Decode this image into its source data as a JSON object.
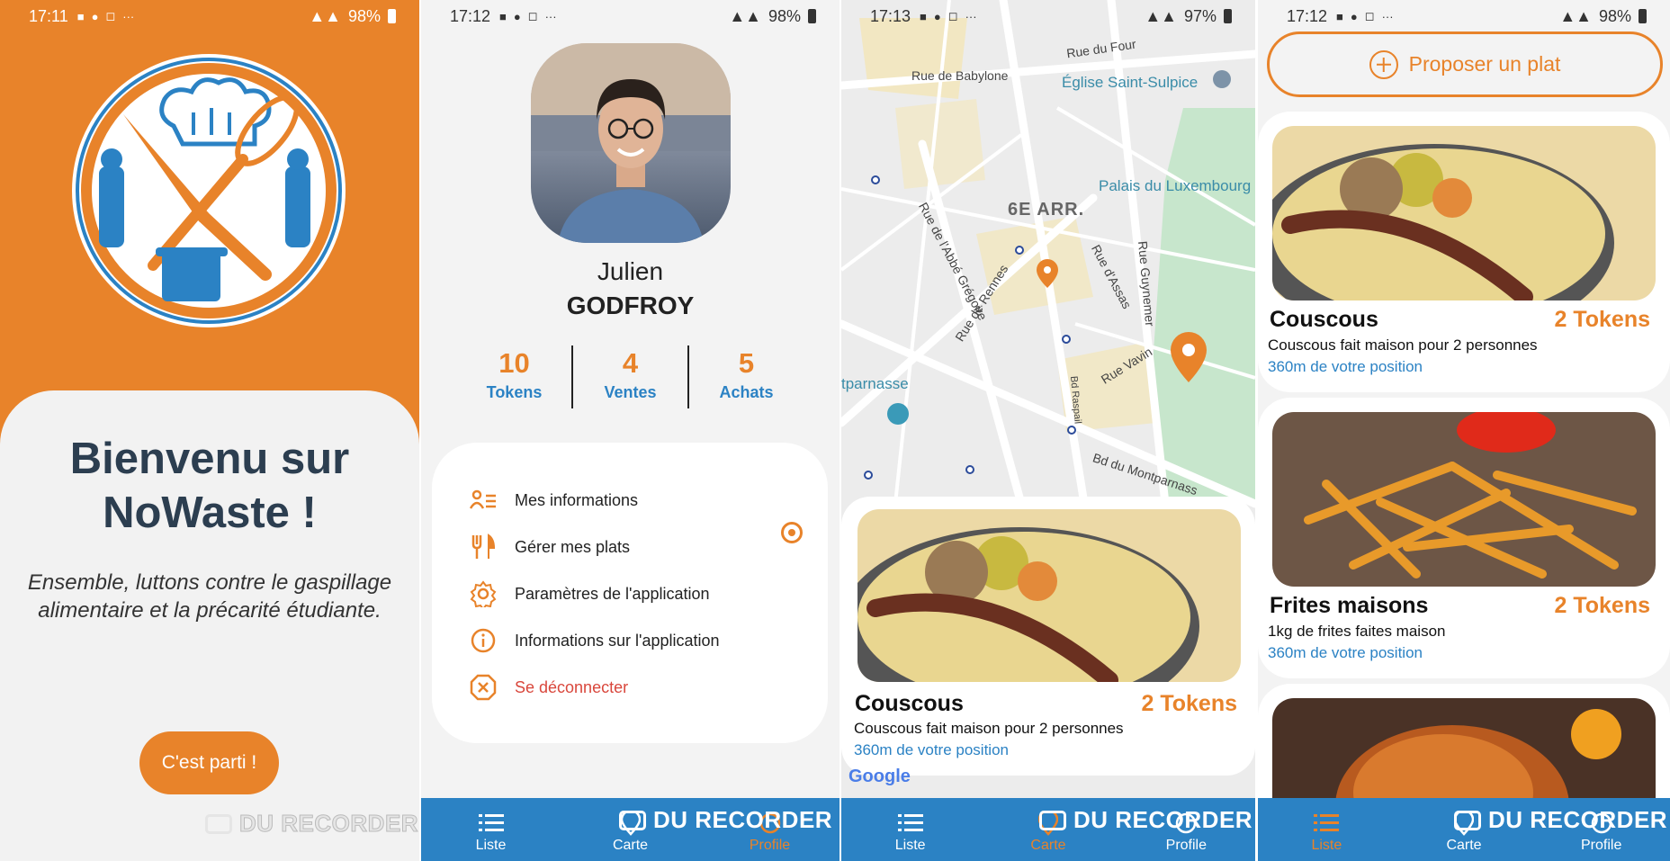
{
  "screen1": {
    "status": {
      "time": "17:11",
      "battery": "98%"
    },
    "title": "Bienvenu sur NoWaste !",
    "subtitle_line1": "Ensemble, luttons contre le gaspillage",
    "subtitle_line2": "alimentaire et la précarité étudiante.",
    "cta": "C'est parti !",
    "watermark": "DU RECORDER"
  },
  "screen2": {
    "status": {
      "time": "17:12",
      "battery": "98%"
    },
    "first_name": "Julien",
    "last_name": "GODFROY",
    "stats": [
      {
        "value": "10",
        "label": "Tokens"
      },
      {
        "value": "4",
        "label": "Ventes"
      },
      {
        "value": "5",
        "label": "Achats"
      }
    ],
    "menu": [
      {
        "label": "Mes informations",
        "icon": "id-card-icon"
      },
      {
        "label": "Gérer mes plats",
        "icon": "utensils-icon"
      },
      {
        "label": "Paramètres de l'application",
        "icon": "gear-icon"
      },
      {
        "label": "Informations sur l'application",
        "icon": "info-icon"
      },
      {
        "label": "Se déconnecter",
        "icon": "logout-x-icon"
      }
    ]
  },
  "screen3": {
    "status": {
      "time": "17:13",
      "battery": "97%"
    },
    "map_labels": {
      "babylone": "Rue de Babylone",
      "four": "Rue du Four",
      "sulpice": "Église Saint-Sulpice",
      "luxembourg": "Palais du Luxembourg",
      "arr": "6E ARR.",
      "gregoire": "Rue de l'Abbé Grégoire",
      "rennes": "Rue de Rennes",
      "assas": "Rue d'Assas",
      "guynemer": "Rue Guynemer",
      "vavin": "Rue Vavin",
      "raspail": "Bd Raspail",
      "montparnasse_bd": "Bd du Montparnass",
      "montparnasse": "tparnasse",
      "google": "Google"
    },
    "card": {
      "title": "Couscous",
      "price": "2 Tokens",
      "desc": "Couscous fait maison pour 2 personnes",
      "dist": "360m de votre position"
    }
  },
  "screen4": {
    "status": {
      "time": "17:12",
      "battery": "98%"
    },
    "propose": "Proposer un plat",
    "dishes": [
      {
        "title": "Couscous",
        "price": "2 Tokens",
        "desc": "Couscous fait maison pour 2 personnes",
        "dist": "360m de votre position"
      },
      {
        "title": "Frites maisons",
        "price": "2 Tokens",
        "desc": "1kg de frites faites maison",
        "dist": "360m de votre position"
      }
    ]
  },
  "nav": {
    "liste": "Liste",
    "carte": "Carte",
    "profile": "Profile"
  },
  "watermark": "DU RECORDER",
  "colors": {
    "orange": "#e8832a",
    "blue": "#2b82c4",
    "navy": "#2c3e50"
  }
}
